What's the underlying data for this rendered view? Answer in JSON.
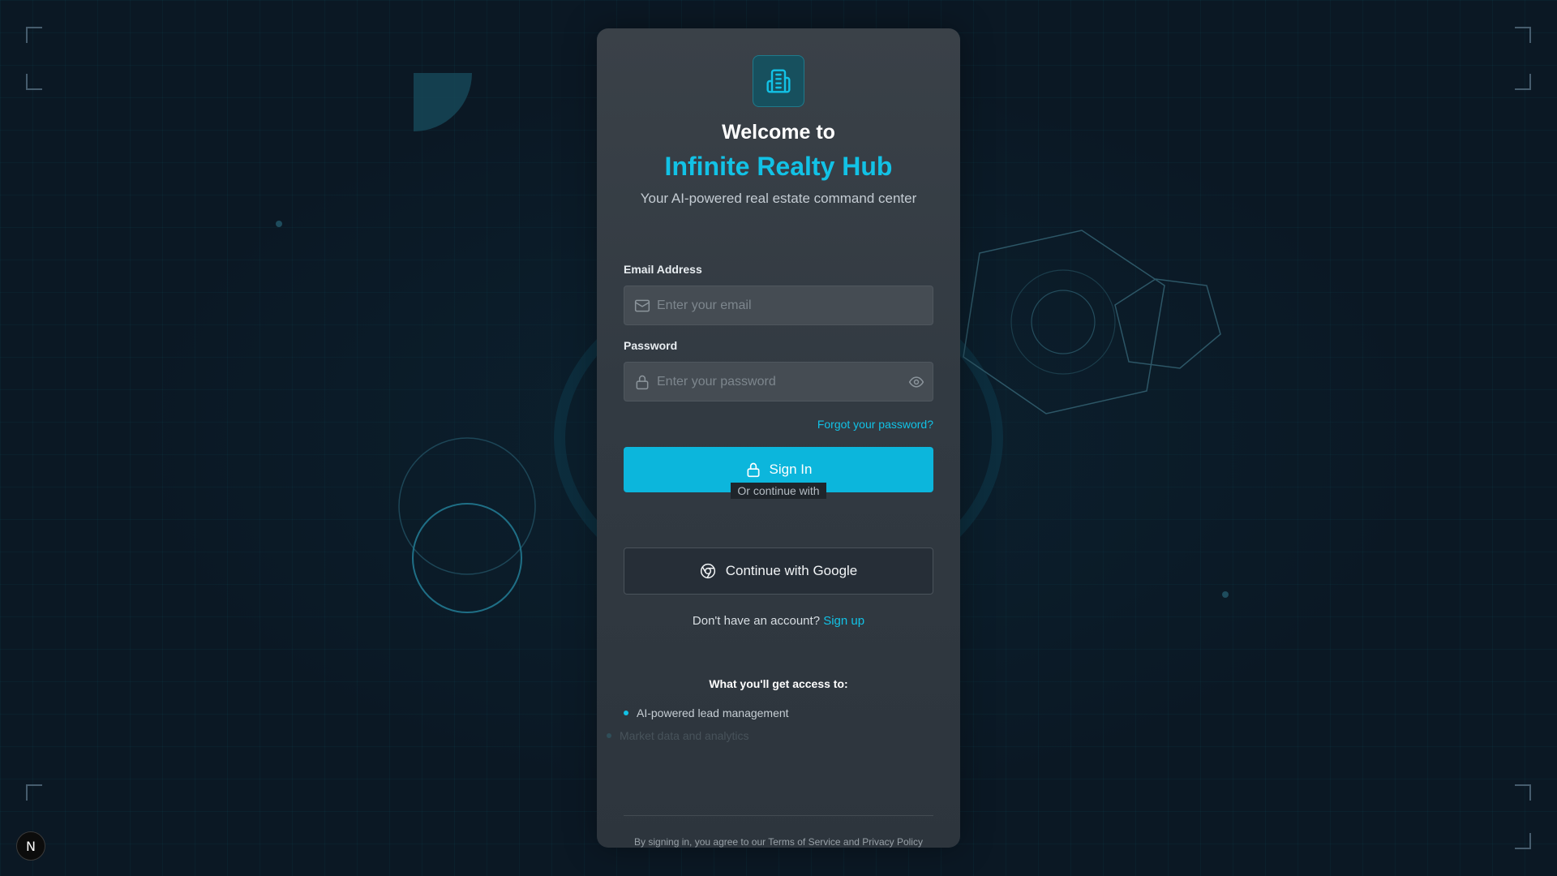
{
  "header": {
    "welcome": "Welcome to",
    "brand": "Infinite Realty Hub",
    "tagline": "Your AI-powered real estate command center"
  },
  "logo_icon": "building-icon",
  "form": {
    "email_label": "Email Address",
    "email_placeholder": "Enter your email",
    "email_value": "",
    "password_label": "Password",
    "password_placeholder": "Enter your password",
    "password_value": "",
    "forgot_link": "Forgot your password?",
    "signin_button": "Sign In",
    "divider_text": "Or continue with",
    "google_button": "Continue with Google",
    "no_account_text": "Don't have an account?",
    "signup_link": "Sign up"
  },
  "access": {
    "title": "What you'll get access to:",
    "features": [
      "AI-powered lead management",
      "Market data and analytics"
    ]
  },
  "footer": {
    "legal": "By signing in, you agree to our Terms of Service and Privacy Policy"
  },
  "dev_badge": "N",
  "colors": {
    "accent": "#12c2e6",
    "button": "#0cb6dc",
    "background": "#0b1824",
    "card": "#353c43"
  }
}
